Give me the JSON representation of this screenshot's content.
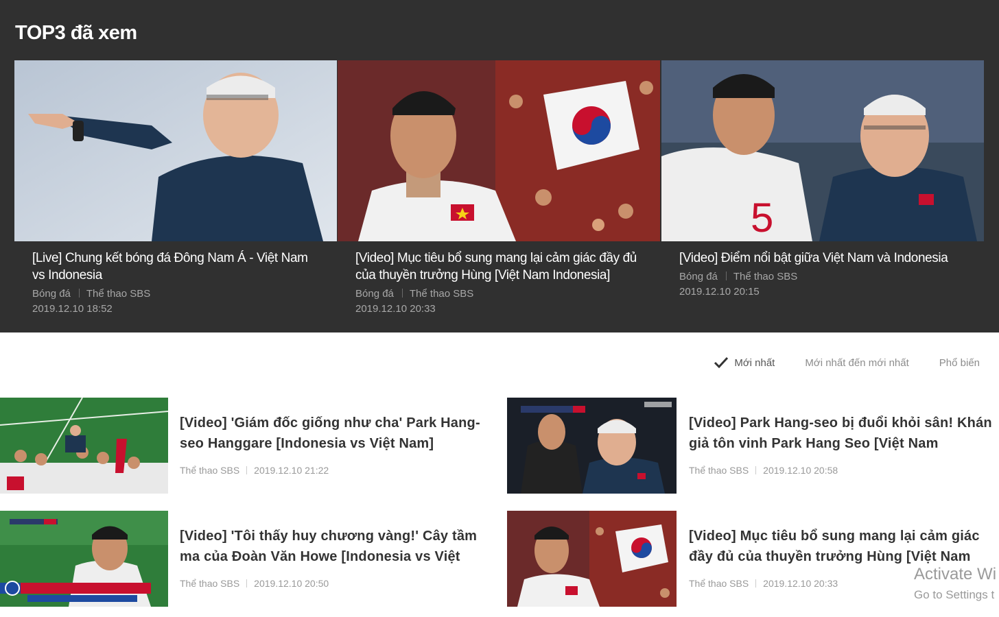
{
  "top3": {
    "heading": "TOP3 đã xem",
    "cards": [
      {
        "title": "[Live] Chung kết bóng đá Đông Nam Á - Việt Nam vs Indonesia",
        "category": "Bóng đá",
        "channel": "Thể thao SBS",
        "date": "2019.12.10 18:52"
      },
      {
        "title": "[Video] Mục tiêu bổ sung mang lại cảm giác đầy đủ của thuyền trưởng Hùng [Việt Nam Indonesia]",
        "category": "Bóng đá",
        "channel": "Thể thao SBS",
        "date": "2019.12.10 20:33"
      },
      {
        "title": "[Video] Điểm nổi bật giữa Việt Nam và Indonesia",
        "category": "Bóng đá",
        "channel": "Thể thao SBS",
        "date": "2019.12.10 20:15"
      }
    ]
  },
  "sort": {
    "options": [
      "Mới nhất",
      "Mới nhất đến mới nhất",
      "Phổ biến"
    ],
    "selected": "Mới nhất"
  },
  "videos": [
    {
      "title": "[Video] 'Giám đốc giống như cha' Park Hang-seo Hanggare [Indonesia vs Việt Nam]",
      "channel": "Thể thao SBS",
      "date": "2019.12.10 21:22"
    },
    {
      "title": "[Video] Park Hang-seo bị đuổi khỏi sân! Khán giả tôn vinh Park Hang Seo [Việt Nam",
      "channel": "Thể thao SBS",
      "date": "2019.12.10 20:58"
    },
    {
      "title": "[Video] 'Tôi thấy huy chương vàng!' Cây tầm ma của Đoàn Văn Howe [Indonesia vs Việt",
      "channel": "Thể thao SBS",
      "date": "2019.12.10 20:50"
    },
    {
      "title": "[Video] Mục tiêu bổ sung mang lại cảm giác đầy đủ của thuyền trưởng Hùng [Việt Nam",
      "channel": "Thể thao SBS",
      "date": "2019.12.10 20:33"
    }
  ],
  "watermark": {
    "line1": "Activate Wi",
    "line2": "Go to Settings t"
  },
  "colors": {
    "top3_background": "#303030",
    "jersey_red": "#c8102e",
    "pitch_green": "#2f7d3a"
  }
}
